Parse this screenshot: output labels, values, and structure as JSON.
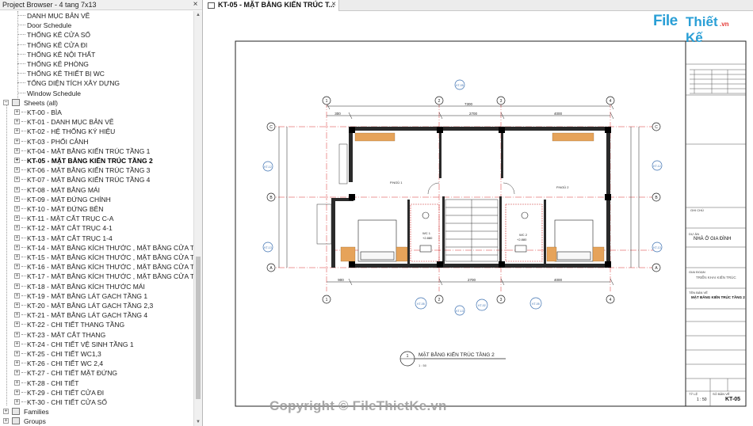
{
  "browser": {
    "title": "Project Browser - 4 tang 7x13",
    "close": "×",
    "schedules": [
      "DANH MỤC BẢN VẼ",
      "Door Schedule",
      "THỐNG KÊ CỬA SỔ",
      "THỐNG KÊ CỬA ĐI",
      "THỐNG KÊ NỘI THẤT",
      "THỐNG KÊ PHÒNG",
      "THỐNG KÊ THIẾT BỊ WC",
      "TỔNG DIỆN TÍCH XÂY DỰNG",
      "Window Schedule"
    ],
    "sheets_label": "Sheets (all)",
    "sheets": [
      "KT-00 - BÌA",
      "KT-01 - DANH MỤC BẢN VẼ",
      "KT-02 - HỆ THỐNG KÝ HIỆU",
      "KT-03 - PHỐI CẢNH",
      "KT-04 - MẶT BẰNG KIẾN TRÚC TẦNG 1",
      "KT-05 - MẶT BẰNG KIẾN TRÚC TẦNG 2",
      "KT-06 - MẶT BẰNG KIẾN TRÚC TẦNG 3",
      "KT-07 - MẶT BẰNG KIẾN TRÚC TẦNG 4",
      "KT-08 - MẶT BẰNG MÁI",
      "KT-09 - MẶT ĐỨNG CHÍNH",
      "KT-10 - MẶT ĐỨNG BÊN",
      "KT-11 - MẶT CẮT TRỤC C-A",
      "KT-12 - MẶT CẮT TRỤC 4-1",
      "KT-13 - MẶT CẮT TRỤC 1-4",
      "KT-14 - MẶT BẰNG KÍCH THƯỚC , MẶT BẰNG CỬA TẦNG",
      "KT-15 - MẶT BẰNG KÍCH THƯỚC , MẶT BẰNG CỬA TẦNG",
      "KT-16 - MẶT BẰNG KÍCH THƯỚC , MẶT BẰNG CỬA TẦNG",
      "KT-17 - MẶT BẰNG KÍCH THƯỚC , MẶT BẰNG CỬA TẦNG",
      "KT-18 - MẶT BẰNG KÍCH THƯỚC MÁI",
      "KT-19 - MẶT BẰNG LÁT GẠCH TẦNG 1",
      "KT-20 - MẶT BẰNG LÁT GẠCH TẦNG 2,3",
      "KT-21 - MẶT BẰNG LÁT GẠCH TẦNG 4",
      "KT-22 - CHI TIẾT THANG TẦNG",
      "KT-23 - MẶT CẮT THANG",
      "KT-24 - CHI TIẾT VỆ SINH TẦNG 1",
      "KT-25 - CHI TIẾT WC1,3",
      "KT-26 - CHI TIẾT WC 2,4",
      "KT-27 - CHI TIẾT MẶT ĐỨNG",
      "KT-28 - CHI TIẾT",
      "KT-29 - CHI TIẾT CỬA ĐI",
      "KT-30 - CHI TIẾT CỬA SỔ"
    ],
    "selected_sheet_index": 5,
    "families_label": "Families",
    "groups_label": "Groups"
  },
  "tab": {
    "label": "KT-05 - MẶT BẰNG KIẾN TRÚC T...",
    "close": "×"
  },
  "logo": {
    "file": "File",
    "rest": "Thiết Kế",
    "vn": ".vn"
  },
  "watermark": "Copyright © FileThietKe.vn",
  "drawing": {
    "title": "MẶT BẰNG KIẾN TRÚC TẦNG 2",
    "scale": "1 : 50",
    "view_no": "1",
    "dim_total": "7300",
    "dims_top": [
      "300",
      "2700",
      "4000"
    ],
    "dims_bottom": [
      "900",
      "2700",
      "4000"
    ],
    "room1": "P.NGỦ 1",
    "room2": "P.NGỦ 2",
    "wc1": "WC 1",
    "wc2": "WC 2",
    "wc_level": "+2.880",
    "grid_letters": [
      "C",
      "B",
      "A"
    ],
    "grid_numbers": [
      "1",
      "2",
      "3",
      "4"
    ],
    "section_tags": [
      "KT-05",
      "KT-12",
      "KT-13",
      "KT-02"
    ]
  },
  "titleblock": {
    "project_label": "DỰ ÁN",
    "project": "NHÀ Ở GIA ĐÌNH",
    "phase_label": "GIAI ĐOẠN",
    "phase": "TRIỂN KHAI KIẾN TRÚC",
    "sheet_title_label": "TÊN BẢN VẼ",
    "sheet_title": "MẶT BẰNG KIẾN TRÚC TẦNG 2",
    "scale_label": "TỶ LỆ",
    "scale": "1 : 50",
    "sheet_no_label": "SỐ BẢN VẼ",
    "sheet_no": "KT-05",
    "revision_label": "SỬA ĐỔI",
    "notes_label": "GHI CHÚ"
  }
}
